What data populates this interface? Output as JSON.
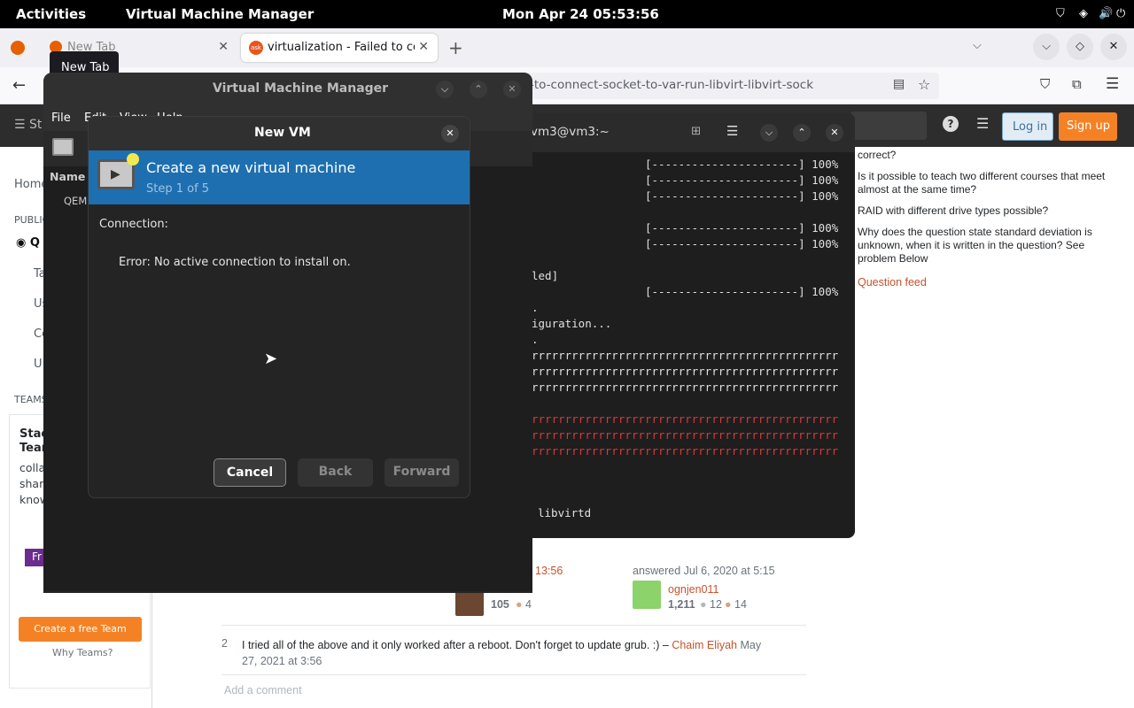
{
  "topbar": {
    "activities": "Activities",
    "app_name": "Virtual Machine Manager",
    "clock": "Mon Apr 24  05:53:56"
  },
  "firefox": {
    "tabs": [
      {
        "label": "New Tab"
      },
      {
        "label": "virtualization - Failed to co"
      }
    ],
    "tooltip": "New Tab",
    "url": "-to-connect-socket-to-var-run-libvirt-libvirt-sock"
  },
  "so": {
    "login": "Log in",
    "signup": "Sign up",
    "left_items": [
      "Home",
      "PUBLIC",
      "Q",
      "Ta",
      "Us",
      "Co",
      "U",
      "TEAMS"
    ],
    "teams_title_1": "Stac",
    "teams_title_2": "Team",
    "teams_text": [
      "colla",
      "shari",
      "know"
    ],
    "fr_badge": "Fr",
    "create_team": "Create a free Team",
    "why_teams": "Why Teams?",
    "side_questions": [
      "correct?",
      "Is it possible to teach two different courses that meet almost at the same time?",
      "RAID with different drive types possible?",
      "Why does the question state standard deviation is unknown, when it is written in the question? See problem Below"
    ],
    "question_feed": "Question feed",
    "answer_time_left": "13:56",
    "answered_label": "answered Jul 6, 2020 at 5:15",
    "user_left_rep": "105",
    "user_left_badge": "4",
    "user_right_name": "ognjen011",
    "user_right_rep": "1,211",
    "user_right_silver": "12",
    "user_right_bronze": "14",
    "comment_score": "2",
    "comment_text": "I tried all of the above and it only worked after a reboot. Don't forget to update grub. :) –",
    "comment_author": "Chaim Eliyah",
    "comment_date_1": "May",
    "comment_date_2": "27, 2021 at 3:56",
    "add_comment": "Add a comment"
  },
  "terminal": {
    "title": "vm3@vm3:~",
    "lines": [
      "[----------------------] 100%",
      "[----------------------] 100%",
      "[----------------------] 100%",
      "[----------------------] 100%",
      "[----------------------] 100%",
      "led]",
      "[----------------------] 100%",
      ".",
      "iguration...",
      ".",
      "rrrrrrrrrrrrrrrrrrrrrrrrrrrrrrrrrrrrrrrrrrrrrr",
      "rrrrrrrrrrrrrrrrrrrrrrrrrrrrrrrrrrrrrrrrrrrrrr",
      "rrrrrrrrrrrrrrrrrrrrrrrrrrrrrrrrrrrrrrrrrrrrrr",
      "rrrrrrrrrrrrrrrrrrrrrrrrrrrrrrrrrrrrrrrrrrrrrr",
      "rrrrrrrrrrrrrrrrrrrrrrrrrrrrrrrrrrrrrrrrrrrrrr",
      "rrrrrrrrrrrrrrrrrrrrrrrrrrrrrrrrrrrrrrrrrrrrrr",
      "libvirtd"
    ]
  },
  "vmm": {
    "title": "Virtual Machine Manager",
    "menu": [
      "File",
      "Edit",
      "View",
      "Help"
    ],
    "column_name": "Name",
    "connection_row": "QEMU"
  },
  "newvm": {
    "title": "New VM",
    "heading": "Create a new virtual machine",
    "step": "Step 1 of 5",
    "connection_label": "Connection:",
    "error": "Error: No active connection to install on.",
    "cancel": "Cancel",
    "back": "Back",
    "forward": "Forward"
  },
  "colors": {
    "accent": "#1e6fb0",
    "so_orange": "#f48225",
    "link": "#c8522a"
  }
}
